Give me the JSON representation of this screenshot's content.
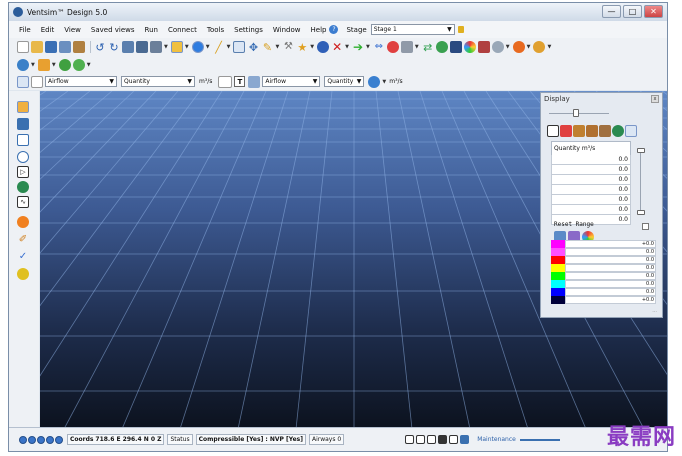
{
  "window": {
    "title": "Ventsim™ Design 5.0",
    "min": "—",
    "max": "□",
    "close": "✕"
  },
  "menu": [
    "File",
    "Edit",
    "View",
    "Saved views",
    "Run",
    "Connect",
    "Tools",
    "Settings",
    "Window",
    "Help"
  ],
  "stage": {
    "label": "Stage",
    "value": "Stage 1"
  },
  "toolbar3": {
    "sel1": "Airflow",
    "sel2": "Quantity",
    "unit1": "m³/s",
    "text_tool": "T",
    "sel3": "Airflow",
    "sel4": "Quantity",
    "unit2": "m³/s"
  },
  "display": {
    "title": "Display",
    "close": "x",
    "quantity_header": "Quantity m³/s",
    "rows": [
      "0.0",
      "0.0",
      "0.0",
      "0.0",
      "0.0",
      "0.0",
      "0.0"
    ],
    "reset_range": "Reset Range",
    "color_rows": [
      "+0.0",
      "0.0",
      "0.0",
      "0.0",
      "0.0",
      "0.0",
      "0.0",
      "+0.0"
    ],
    "more": "...",
    "colors": [
      "#ff00ff",
      "#ff4fff",
      "#ff0000",
      "#ffff00",
      "#00ff00",
      "#00ffff",
      "#0000ff",
      "#00003a"
    ]
  },
  "status": {
    "coords_label": "Coords",
    "coords": "718.6 E   296.4 N   0 Z",
    "status_label": "Status",
    "status_value": "Compressible [Yes] : NVP [Yes]",
    "airways": "Airways 0",
    "maintenance": "Maintenance"
  },
  "watermark": "最需网"
}
